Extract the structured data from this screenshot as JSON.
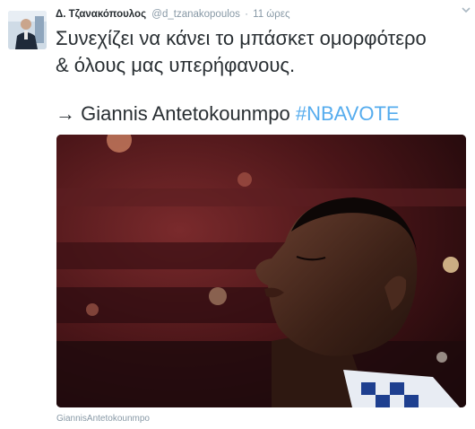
{
  "tweet": {
    "display_name": "Δ. Τζανακόπουλος",
    "handle": "@d_tzanakopoulos",
    "separator": "·",
    "time": "11 ώρες",
    "text_line1": "Συνεχίζει να κάνει το μπάσκετ ομορφότερο",
    "text_line2": "& όλους μας υπερήφανους.",
    "arrow_text": "→ Giannis Antetokounmpo ",
    "hashtag": "#NBAVOTE",
    "media_caption": "GiannisAntetokounmpo"
  },
  "icons": {
    "more": "chevron-down-icon"
  },
  "colors": {
    "text": "#292f33",
    "muted": "#8899a6",
    "link": "#55acee"
  }
}
